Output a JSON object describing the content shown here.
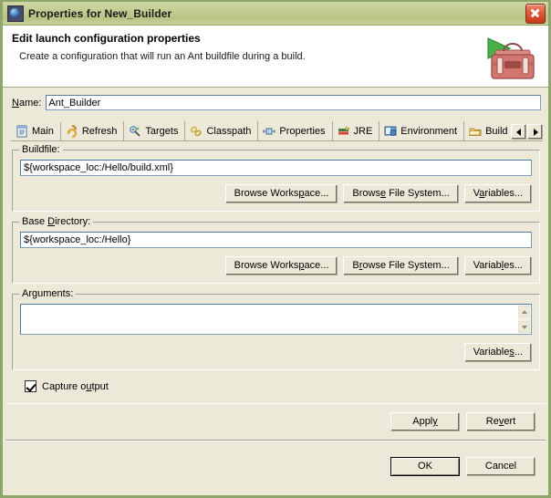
{
  "window": {
    "title": "Properties for New_Builder",
    "icon": "globe-icon",
    "close_label": "×",
    "border_color": "#8fa66a",
    "titlebar_color": "#c2cc90",
    "body_color": "#ece9d8"
  },
  "header": {
    "title": "Edit launch configuration properties",
    "subtitle": "Create a configuration that will run an Ant buildfile during a build.",
    "icon": "ant-toolbox-icon"
  },
  "name_field": {
    "label": "Name:",
    "value": "Ant_Builder"
  },
  "tabs": {
    "selected": "Main",
    "items": [
      {
        "label": "Main",
        "icon": "document-icon",
        "selected": true
      },
      {
        "label": "Refresh",
        "icon": "refresh-arrows-icon",
        "selected": false
      },
      {
        "label": "Targets",
        "icon": "targets-icon",
        "selected": false
      },
      {
        "label": "Classpath",
        "icon": "classpath-icon",
        "selected": false
      },
      {
        "label": "Properties",
        "icon": "properties-icon",
        "selected": false
      },
      {
        "label": "JRE",
        "icon": "jre-icon",
        "selected": false
      },
      {
        "label": "Environment",
        "icon": "environment-icon",
        "selected": false
      },
      {
        "label": "Build C",
        "icon": "folder-icon",
        "selected": false
      }
    ],
    "scroll_left": "◄",
    "scroll_right": "►"
  },
  "buildfile": {
    "group_label": "Buildfile:",
    "value": "${workspace_loc:/Hello/build.xml}",
    "browse_workspace": "Browse Workspace...",
    "browse_filesystem": "Browse File System...",
    "variables": "Variables..."
  },
  "base_directory": {
    "group_label": "Base Directory:",
    "value": "${workspace_loc:/Hello}",
    "browse_workspace": "Browse Workspace...",
    "browse_filesystem": "Browse File System...",
    "variables": "Variables..."
  },
  "arguments": {
    "group_label": "Arguments:",
    "value": "",
    "variables": "Variables..."
  },
  "capture_output": {
    "label": "Capture output",
    "checked": true
  },
  "footer": {
    "apply": "Apply",
    "revert": "Revert",
    "ok": "OK",
    "cancel": "Cancel"
  }
}
